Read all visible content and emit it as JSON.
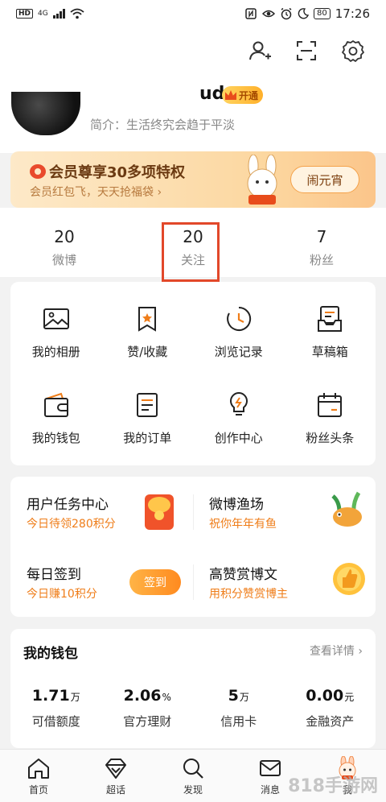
{
  "status_bar": {
    "network": "HD",
    "signal": "4G",
    "vpn": "",
    "battery": "80",
    "time": "17:26"
  },
  "profile": {
    "username": "ud",
    "vip_badge": "开通",
    "bio": "简介：生活终究会趋于平淡"
  },
  "banner": {
    "title": "会员尊享30多项特权",
    "subtitle": "会员红包飞，天天抢福袋 ›",
    "button": "闹元宵"
  },
  "stats": [
    {
      "value": "20",
      "label": "微博"
    },
    {
      "value": "20",
      "label": "关注"
    },
    {
      "value": "7",
      "label": "粉丝"
    }
  ],
  "shortcuts": [
    {
      "label": "我的相册",
      "icon": "album-icon"
    },
    {
      "label": "赞/收藏",
      "icon": "like-collect-icon"
    },
    {
      "label": "浏览记录",
      "icon": "history-icon"
    },
    {
      "label": "草稿箱",
      "icon": "drafts-icon"
    },
    {
      "label": "我的钱包",
      "icon": "wallet-icon"
    },
    {
      "label": "我的订单",
      "icon": "orders-icon"
    },
    {
      "label": "创作中心",
      "icon": "lightbulb-icon"
    },
    {
      "label": "粉丝头条",
      "icon": "calendar-icon"
    }
  ],
  "tasks": [
    {
      "title": "用户任务中心",
      "sub": "今日待领280积分"
    },
    {
      "title": "微博渔场",
      "sub": "祝你年年有鱼"
    },
    {
      "title": "每日签到",
      "sub": "今日赚10积分",
      "button": "签到"
    },
    {
      "title": "高赞赏博文",
      "sub": "用积分赞赏博主"
    }
  ],
  "wallet": {
    "title": "我的钱包",
    "more": "查看详情",
    "items": [
      {
        "value": "1.71",
        "unit": "万",
        "label": "可借额度"
      },
      {
        "value": "2.06",
        "unit": "%",
        "label": "官方理财"
      },
      {
        "value": "5",
        "unit": "万",
        "label": "信用卡"
      },
      {
        "value": "0.00",
        "unit": "元",
        "label": "金融资产"
      }
    ]
  },
  "tabbar": [
    {
      "label": "首页",
      "icon": "home-icon"
    },
    {
      "label": "超话",
      "icon": "diamond-icon"
    },
    {
      "label": "发现",
      "icon": "search-icon"
    },
    {
      "label": "消息",
      "icon": "mail-icon"
    },
    {
      "label": "我",
      "icon": "mascot-icon"
    }
  ],
  "watermark": "818手游网",
  "colors": {
    "accent": "#ef7d19",
    "highlight_box": "#e2482a",
    "page_bg": "#f2f2f2"
  }
}
